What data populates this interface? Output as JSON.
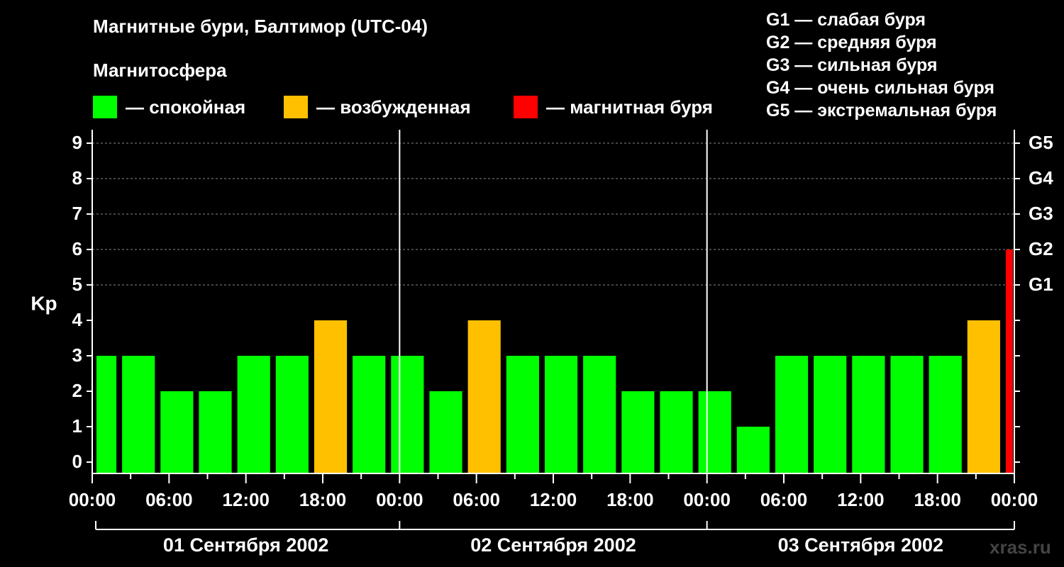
{
  "title": "Магнитные бури, Балтимор (UTC-04)",
  "subtitle": "Магнитосфера",
  "legend": [
    {
      "label": "— спокойная",
      "color": "#00ff00"
    },
    {
      "label": "— возбужденная",
      "color": "#ffc000"
    },
    {
      "label": "— магнитная буря",
      "color": "#ff0000"
    }
  ],
  "gscale": [
    "G1 — слабая буря",
    "G2 — средняя буря",
    "G3 — сильная буря",
    "G4 — очень сильная буря",
    "G5 — экстремальная буря"
  ],
  "watermark": "xras.ru",
  "colors": {
    "quiet": "#00ff00",
    "active": "#ffc000",
    "storm": "#ff0000",
    "grid": "#888888"
  },
  "chart_data": {
    "type": "bar",
    "ylabel": "Kp",
    "ylim": [
      0,
      9
    ],
    "yticks": [
      0,
      1,
      2,
      3,
      4,
      5,
      6,
      7,
      8,
      9
    ],
    "right_ticks": [
      {
        "value": 5,
        "label": "G1"
      },
      {
        "value": 6,
        "label": "G2"
      },
      {
        "value": 7,
        "label": "G3"
      },
      {
        "value": 8,
        "label": "G4"
      },
      {
        "value": 9,
        "label": "G5"
      }
    ],
    "xlim_hours": [
      0,
      72
    ],
    "xtick_labels": [
      "00:00",
      "06:00",
      "12:00",
      "18:00",
      "00:00",
      "06:00",
      "12:00",
      "18:00",
      "00:00",
      "06:00",
      "12:00",
      "18:00",
      "00:00"
    ],
    "days": [
      "01 Сентября 2002",
      "02 Сентября 2002",
      "03 Сентября 2002"
    ],
    "grid": "horizontal dashed",
    "bars": [
      {
        "start": 0,
        "end": 2,
        "kp": 3,
        "level": "quiet"
      },
      {
        "start": 2,
        "end": 5,
        "kp": 3,
        "level": "quiet"
      },
      {
        "start": 5,
        "end": 8,
        "kp": 2,
        "level": "quiet"
      },
      {
        "start": 8,
        "end": 11,
        "kp": 2,
        "level": "quiet"
      },
      {
        "start": 11,
        "end": 14,
        "kp": 3,
        "level": "quiet"
      },
      {
        "start": 14,
        "end": 17,
        "kp": 3,
        "level": "quiet"
      },
      {
        "start": 17,
        "end": 20,
        "kp": 4,
        "level": "active"
      },
      {
        "start": 20,
        "end": 23,
        "kp": 3,
        "level": "quiet"
      },
      {
        "start": 23,
        "end": 26,
        "kp": 3,
        "level": "quiet"
      },
      {
        "start": 26,
        "end": 29,
        "kp": 2,
        "level": "quiet"
      },
      {
        "start": 29,
        "end": 32,
        "kp": 4,
        "level": "active"
      },
      {
        "start": 32,
        "end": 35,
        "kp": 3,
        "level": "quiet"
      },
      {
        "start": 35,
        "end": 38,
        "kp": 3,
        "level": "quiet"
      },
      {
        "start": 38,
        "end": 41,
        "kp": 3,
        "level": "quiet"
      },
      {
        "start": 41,
        "end": 44,
        "kp": 2,
        "level": "quiet"
      },
      {
        "start": 44,
        "end": 47,
        "kp": 2,
        "level": "quiet"
      },
      {
        "start": 47,
        "end": 50,
        "kp": 2,
        "level": "quiet"
      },
      {
        "start": 50,
        "end": 53,
        "kp": 1,
        "level": "quiet"
      },
      {
        "start": 53,
        "end": 56,
        "kp": 3,
        "level": "quiet"
      },
      {
        "start": 56,
        "end": 59,
        "kp": 3,
        "level": "quiet"
      },
      {
        "start": 59,
        "end": 62,
        "kp": 3,
        "level": "quiet"
      },
      {
        "start": 62,
        "end": 65,
        "kp": 3,
        "level": "quiet"
      },
      {
        "start": 65,
        "end": 68,
        "kp": 3,
        "level": "quiet"
      },
      {
        "start": 68,
        "end": 71,
        "kp": 4,
        "level": "active"
      },
      {
        "start": 71,
        "end": 72,
        "kp": 6,
        "level": "storm"
      }
    ]
  }
}
